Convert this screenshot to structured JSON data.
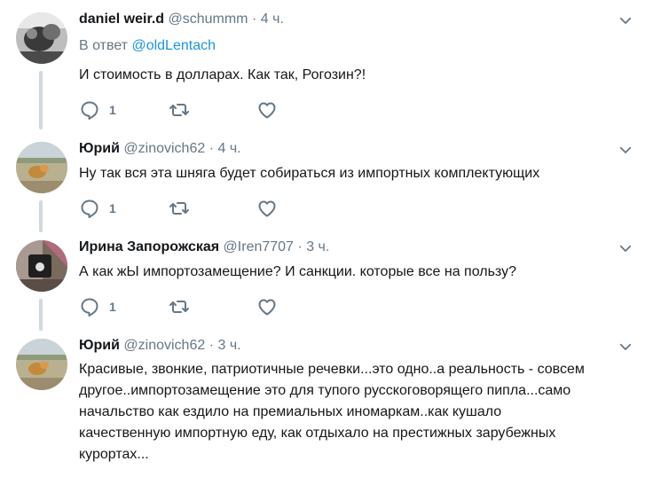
{
  "colors": {
    "accent": "#1b95e0",
    "muted": "#657786",
    "thread_line": "#cfd9de"
  },
  "tweets": [
    {
      "name": "daniel weir.d",
      "handle": "@schummm",
      "separator": "·",
      "time": "4 ч.",
      "reply_prefix": "В ответ ",
      "reply_mention": "@oldLentach",
      "text": "И стоимость в долларах. Как так, Рогозин?!",
      "reply_count": "1",
      "icons": [
        "reply-icon",
        "retweet-icon",
        "like-icon",
        "chevron-down-icon"
      ]
    },
    {
      "name": "Юрий",
      "handle": "@zinovich62",
      "separator": "·",
      "time": "4 ч.",
      "text": "Ну так вся эта шняга будет собираться из импортных комплектующих",
      "reply_count": "1",
      "icons": [
        "reply-icon",
        "retweet-icon",
        "like-icon",
        "chevron-down-icon"
      ]
    },
    {
      "name": "Ирина Запорожская",
      "handle": "@Iren7707",
      "separator": "·",
      "time": "3 ч.",
      "text": "А как жЫ импортозамещение? И санкции. которые все на пользу?",
      "reply_count": "1",
      "icons": [
        "reply-icon",
        "retweet-icon",
        "like-icon",
        "chevron-down-icon"
      ]
    },
    {
      "name": "Юрий",
      "handle": "@zinovich62",
      "separator": "·",
      "time": "3 ч.",
      "text_lines": [
        "Красивые, звонкие, патриотичные речевки...это одно..а реальность - совсем",
        "другое..импортозамещение это для тупого русскоговорящего пипла...само",
        "начальство как ездило на премиальных иномаркам..как кушало",
        "качественную импортную еду, как отдыхало на престижных зарубежных",
        "курортах..."
      ],
      "icons": [
        "chevron-down-icon"
      ]
    }
  ]
}
